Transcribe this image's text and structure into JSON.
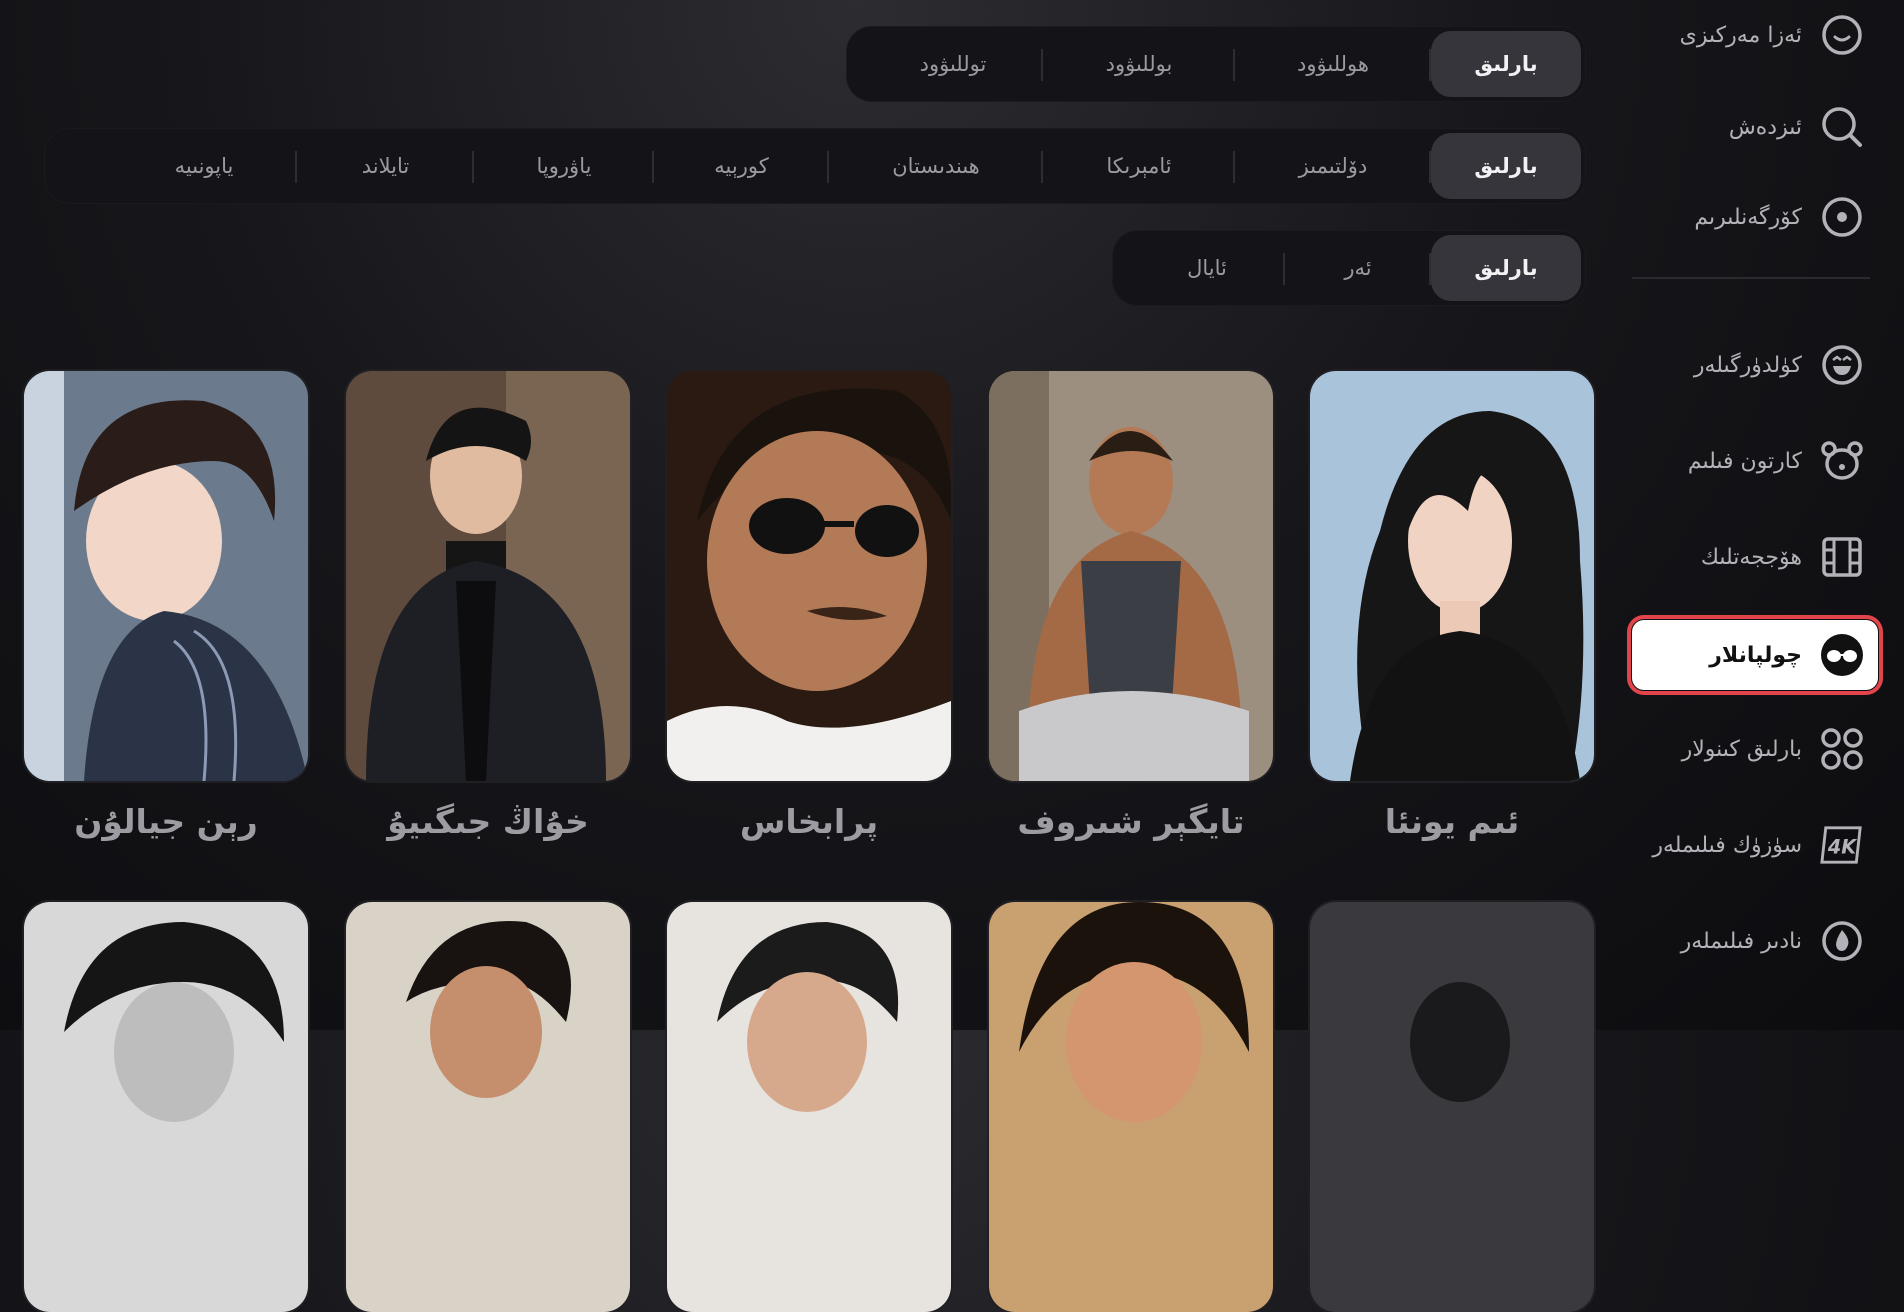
{
  "filters": {
    "row1": [
      "بارلىق",
      "ھوللىۋود",
      "بوللىۋود",
      "توللىۋود"
    ],
    "row2": [
      "بارلىق",
      "دۆلتىمىز",
      "ئامېرىكا",
      "ھىندىستان",
      "كورېيە",
      "ياۋروپا",
      "تايلاند",
      "ياپونىيە"
    ],
    "row3": [
      "بارلىق",
      "ئەر",
      "ئايال"
    ]
  },
  "sidebar": {
    "items": [
      {
        "label": "ئەزا مەركىزى",
        "icon": "smile-circle-icon"
      },
      {
        "label": "ئىزدەش",
        "icon": "search-icon"
      },
      {
        "label": "كۆرگەنلىرىم",
        "icon": "eye-circle-icon"
      },
      {
        "label": "كۈلدۈرگىلەر",
        "icon": "laugh-icon"
      },
      {
        "label": "كارتون فىلىم",
        "icon": "bear-icon"
      },
      {
        "label": "ھۆججەتلىك",
        "icon": "film-strip-icon"
      },
      {
        "label": "چولپانلار",
        "icon": "sunglasses-icon",
        "active": true
      },
      {
        "label": "بارلىق كىنولار",
        "icon": "grid-icon"
      },
      {
        "label": "سۈزۈك فىلىملەر",
        "icon": "4k-icon"
      },
      {
        "label": "نادىر فىلىملەر",
        "icon": "flame-icon"
      }
    ]
  },
  "stars": {
    "row1": [
      "ئىم يونئا",
      "تايگېر شىروف",
      "پرابخاس",
      "خۇاڭ جىگىيۇ",
      "رېن جيالۇن"
    ]
  },
  "colors": {
    "accent": "#e2444b",
    "active_chip": "#35353b"
  }
}
